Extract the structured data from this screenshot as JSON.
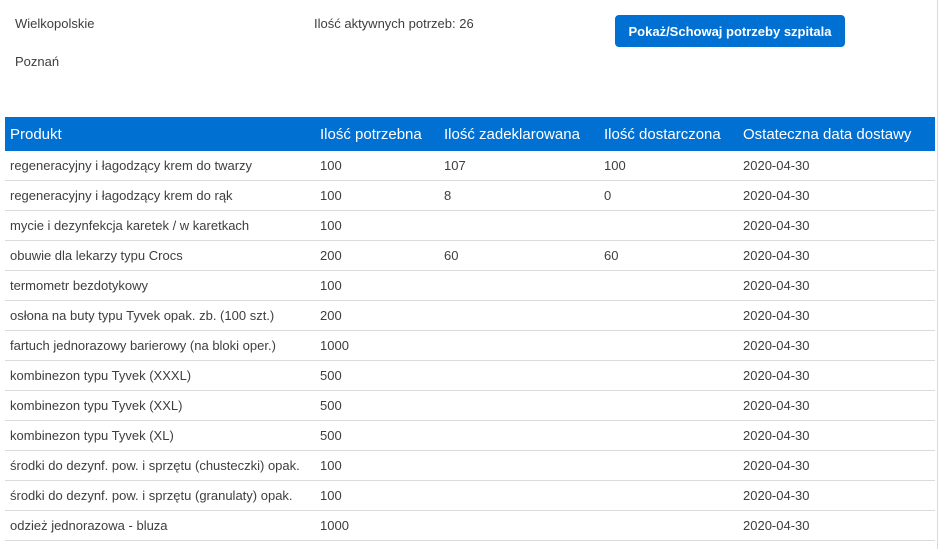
{
  "hospital": {
    "region": "Wielkopolskie",
    "city": "Poznań",
    "active_needs_text": "Ilość aktywnych potrzeb: 26",
    "toggle_button_label": "Pokaż/Schowaj potrzeby szpitala"
  },
  "needs_table": {
    "columns": [
      "Produkt",
      "Ilość potrzebna",
      "Ilość zadeklarowana",
      "Ilość dostarczona",
      "Ostateczna data dostawy"
    ],
    "rows": [
      {
        "product": "regeneracyjny i łagodzący krem do twarzy",
        "needed": "100",
        "declared": "107",
        "delivered": "100",
        "date": "2020-04-30"
      },
      {
        "product": "regeneracyjny i łagodzący krem do rąk",
        "needed": "100",
        "declared": "8",
        "delivered": "0",
        "date": "2020-04-30"
      },
      {
        "product": "mycie i dezynfekcja karetek / w karetkach",
        "needed": "100",
        "declared": "",
        "delivered": "",
        "date": "2020-04-30"
      },
      {
        "product": "obuwie dla lekarzy typu Crocs",
        "needed": "200",
        "declared": "60",
        "delivered": "60",
        "date": "2020-04-30"
      },
      {
        "product": "termometr bezdotykowy",
        "needed": "100",
        "declared": "",
        "delivered": "",
        "date": "2020-04-30"
      },
      {
        "product": "osłona na buty typu Tyvek opak. zb. (100 szt.)",
        "needed": "200",
        "declared": "",
        "delivered": "",
        "date": "2020-04-30"
      },
      {
        "product": "fartuch jednorazowy barierowy (na bloki oper.)",
        "needed": "1000",
        "declared": "",
        "delivered": "",
        "date": "2020-04-30"
      },
      {
        "product": "kombinezon typu Tyvek (XXXL)",
        "needed": "500",
        "declared": "",
        "delivered": "",
        "date": "2020-04-30"
      },
      {
        "product": "kombinezon typu Tyvek (XXL)",
        "needed": "500",
        "declared": "",
        "delivered": "",
        "date": "2020-04-30"
      },
      {
        "product": "kombinezon typu Tyvek (XL)",
        "needed": "500",
        "declared": "",
        "delivered": "",
        "date": "2020-04-30"
      },
      {
        "product": "środki do dezynf. pow. i sprzętu (chusteczki) opak.",
        "needed": "100",
        "declared": "",
        "delivered": "",
        "date": "2020-04-30"
      },
      {
        "product": "środki do dezynf. pow. i sprzętu (granulaty) opak.",
        "needed": "100",
        "declared": "",
        "delivered": "",
        "date": "2020-04-30"
      },
      {
        "product": "odzież jednorazowa - bluza",
        "needed": "1000",
        "declared": "",
        "delivered": "",
        "date": "2020-04-30"
      }
    ]
  },
  "colors": {
    "accent": "#0070d2",
    "text": "#3e3e3c",
    "row_divider": "#dddbda"
  }
}
